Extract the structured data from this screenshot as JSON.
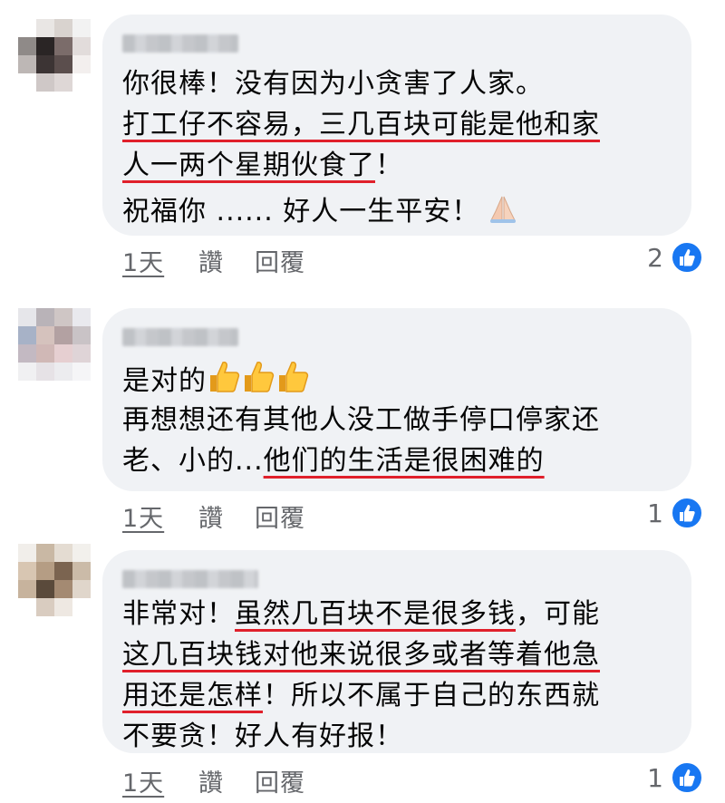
{
  "comments": [
    {
      "lines": [
        "你很棒！没有因为小贪害了人家。",
        "打工仔不容易，三几百块可能是他和家",
        "人一两个星期伙食了",
        "！",
        "祝福你 ...... 好人一生平安！"
      ],
      "time": "1天",
      "like_label": "讚",
      "reply_label": "回覆",
      "reaction_count": "2",
      "avatar_colors": [
        "#ffffff",
        "#e9e6e4",
        "#d9d3cf",
        "#f2f2f2",
        "#8f8a88",
        "#2a2525",
        "#7b6c6a",
        "#e2dcdb",
        "#bdb7b5",
        "#3c3434",
        "#5b4e4d",
        "#f3efee",
        "#ffffff",
        "#cfc8c7",
        "#ded7d6",
        "#ffffff"
      ]
    },
    {
      "lines": [
        "是对的",
        "再想想还有其他人没工做手停口停家还",
        "老、小的...",
        "他们的生活是很困难的"
      ],
      "time": "1天",
      "like_label": "讚",
      "reply_label": "回覆",
      "reaction_count": "1",
      "avatar_colors": [
        "#e6e6ea",
        "#b9b3b8",
        "#cfc6c5",
        "#e9e9ee",
        "#a7b2c7",
        "#d5c2bd",
        "#b3a1a2",
        "#c9c3c6",
        "#c3b9c2",
        "#d0b8b6",
        "#e6cfd1",
        "#dfd4d7",
        "#f0f0f2",
        "#e6e2e6",
        "#ececef",
        "#f5f5f7"
      ]
    },
    {
      "lines": [
        "非常对！",
        "虽然几百块不是很多钱",
        "，可能",
        "这几百块钱对他来说很多或者等着他急",
        "用还是怎样",
        "！所以不属于自己的东西就",
        "不要贪！好人有好报！"
      ],
      "time": "1天",
      "like_label": "讚",
      "reply_label": "回覆",
      "reaction_count": "1",
      "avatar_colors": [
        "#f1eeea",
        "#c9b8a4",
        "#e4dcd2",
        "#f2f0ec",
        "#d8c6b2",
        "#b59d84",
        "#7b6450",
        "#cbbba8",
        "#c7b39d",
        "#5a4a3b",
        "#a48a72",
        "#e0d6cb",
        "#ffffff",
        "#d9ccc0",
        "#eee8e2",
        "#ffffff"
      ]
    }
  ],
  "colors": {
    "bubble": "#f0f2f5",
    "underline": "#e0202b",
    "like_blue": "#1877f2",
    "meta_gray": "#65676b"
  }
}
